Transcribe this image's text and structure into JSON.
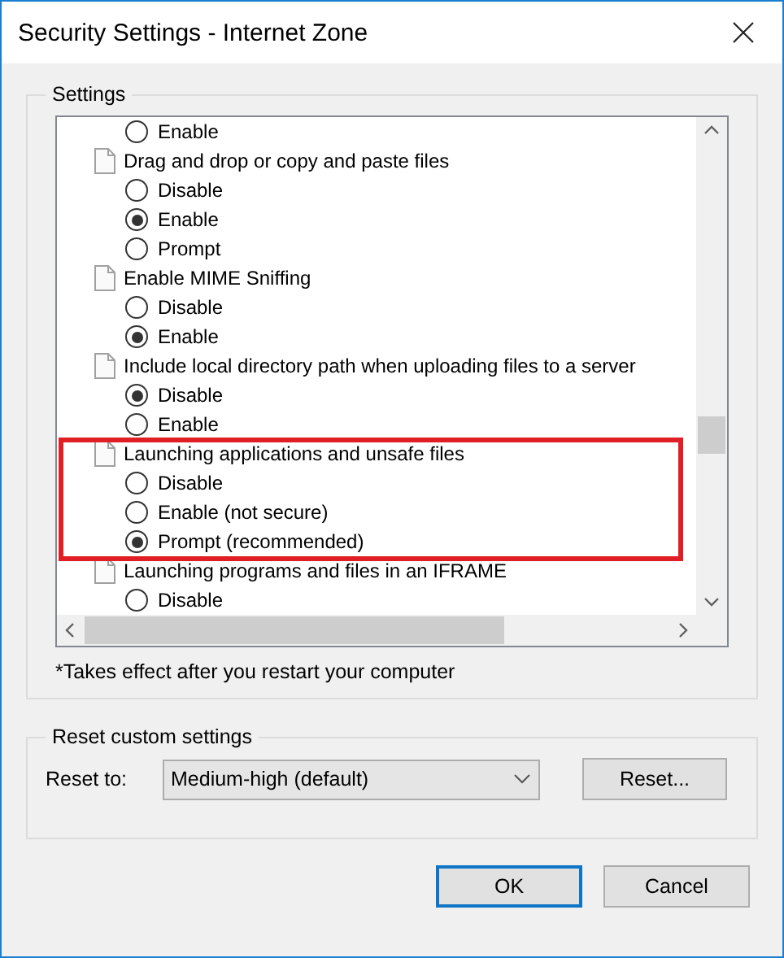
{
  "window": {
    "title": "Security Settings - Internet Zone"
  },
  "settings": {
    "label": "Settings",
    "items": [
      {
        "kind": "option",
        "label": "Enable",
        "selected": false
      },
      {
        "kind": "group",
        "label": "Drag and drop or copy and paste files",
        "children": [
          {
            "kind": "option",
            "label": "Disable",
            "selected": false
          },
          {
            "kind": "option",
            "label": "Enable",
            "selected": true
          },
          {
            "kind": "option",
            "label": "Prompt",
            "selected": false
          }
        ]
      },
      {
        "kind": "group",
        "label": "Enable MIME Sniffing",
        "children": [
          {
            "kind": "option",
            "label": "Disable",
            "selected": false
          },
          {
            "kind": "option",
            "label": "Enable",
            "selected": true
          }
        ]
      },
      {
        "kind": "group",
        "label": "Include local directory path when uploading files to a server",
        "children": [
          {
            "kind": "option",
            "label": "Disable",
            "selected": true
          },
          {
            "kind": "option",
            "label": "Enable",
            "selected": false
          }
        ]
      },
      {
        "kind": "group",
        "label": "Launching applications and unsafe files",
        "children": [
          {
            "kind": "option",
            "label": "Disable",
            "selected": false
          },
          {
            "kind": "option",
            "label": "Enable (not secure)",
            "selected": false
          },
          {
            "kind": "option",
            "label": "Prompt (recommended)",
            "selected": true
          }
        ]
      },
      {
        "kind": "group",
        "label": "Launching programs and files in an IFRAME",
        "children": [
          {
            "kind": "option",
            "label": "Disable",
            "selected": false
          }
        ]
      }
    ],
    "note": "*Takes effect after you restart your computer"
  },
  "reset": {
    "label": "Reset custom settings",
    "field_label": "Reset to:",
    "value": "Medium-high (default)",
    "button": "Reset..."
  },
  "buttons": [
    {
      "label": "OK",
      "default": true
    },
    {
      "label": "Cancel",
      "default": false
    }
  ]
}
